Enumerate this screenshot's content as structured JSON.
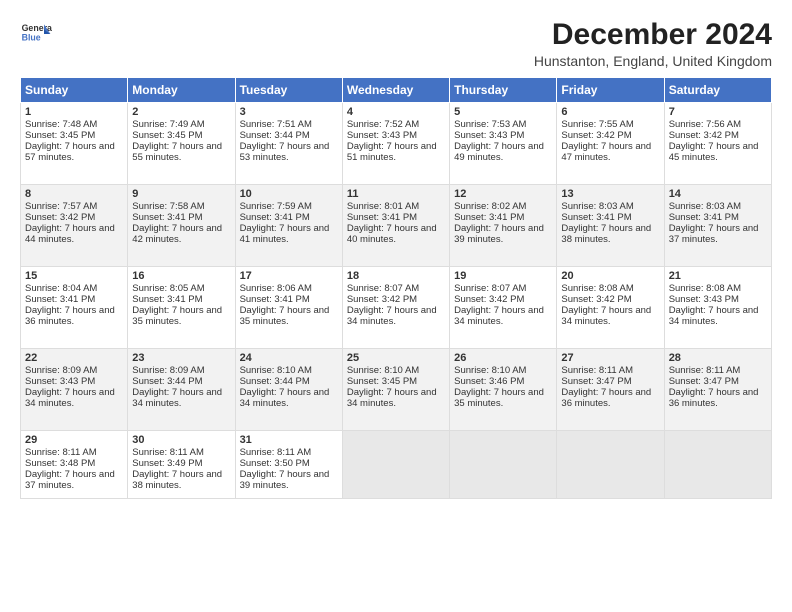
{
  "logo": {
    "line1": "General",
    "line2": "Blue"
  },
  "title": "December 2024",
  "subtitle": "Hunstanton, England, United Kingdom",
  "weekdays": [
    "Sunday",
    "Monday",
    "Tuesday",
    "Wednesday",
    "Thursday",
    "Friday",
    "Saturday"
  ],
  "weeks": [
    [
      {
        "day": "1",
        "sunrise": "Sunrise: 7:48 AM",
        "sunset": "Sunset: 3:45 PM",
        "daylight": "Daylight: 7 hours and 57 minutes."
      },
      {
        "day": "2",
        "sunrise": "Sunrise: 7:49 AM",
        "sunset": "Sunset: 3:45 PM",
        "daylight": "Daylight: 7 hours and 55 minutes."
      },
      {
        "day": "3",
        "sunrise": "Sunrise: 7:51 AM",
        "sunset": "Sunset: 3:44 PM",
        "daylight": "Daylight: 7 hours and 53 minutes."
      },
      {
        "day": "4",
        "sunrise": "Sunrise: 7:52 AM",
        "sunset": "Sunset: 3:43 PM",
        "daylight": "Daylight: 7 hours and 51 minutes."
      },
      {
        "day": "5",
        "sunrise": "Sunrise: 7:53 AM",
        "sunset": "Sunset: 3:43 PM",
        "daylight": "Daylight: 7 hours and 49 minutes."
      },
      {
        "day": "6",
        "sunrise": "Sunrise: 7:55 AM",
        "sunset": "Sunset: 3:42 PM",
        "daylight": "Daylight: 7 hours and 47 minutes."
      },
      {
        "day": "7",
        "sunrise": "Sunrise: 7:56 AM",
        "sunset": "Sunset: 3:42 PM",
        "daylight": "Daylight: 7 hours and 45 minutes."
      }
    ],
    [
      {
        "day": "8",
        "sunrise": "Sunrise: 7:57 AM",
        "sunset": "Sunset: 3:42 PM",
        "daylight": "Daylight: 7 hours and 44 minutes."
      },
      {
        "day": "9",
        "sunrise": "Sunrise: 7:58 AM",
        "sunset": "Sunset: 3:41 PM",
        "daylight": "Daylight: 7 hours and 42 minutes."
      },
      {
        "day": "10",
        "sunrise": "Sunrise: 7:59 AM",
        "sunset": "Sunset: 3:41 PM",
        "daylight": "Daylight: 7 hours and 41 minutes."
      },
      {
        "day": "11",
        "sunrise": "Sunrise: 8:01 AM",
        "sunset": "Sunset: 3:41 PM",
        "daylight": "Daylight: 7 hours and 40 minutes."
      },
      {
        "day": "12",
        "sunrise": "Sunrise: 8:02 AM",
        "sunset": "Sunset: 3:41 PM",
        "daylight": "Daylight: 7 hours and 39 minutes."
      },
      {
        "day": "13",
        "sunrise": "Sunrise: 8:03 AM",
        "sunset": "Sunset: 3:41 PM",
        "daylight": "Daylight: 7 hours and 38 minutes."
      },
      {
        "day": "14",
        "sunrise": "Sunrise: 8:03 AM",
        "sunset": "Sunset: 3:41 PM",
        "daylight": "Daylight: 7 hours and 37 minutes."
      }
    ],
    [
      {
        "day": "15",
        "sunrise": "Sunrise: 8:04 AM",
        "sunset": "Sunset: 3:41 PM",
        "daylight": "Daylight: 7 hours and 36 minutes."
      },
      {
        "day": "16",
        "sunrise": "Sunrise: 8:05 AM",
        "sunset": "Sunset: 3:41 PM",
        "daylight": "Daylight: 7 hours and 35 minutes."
      },
      {
        "day": "17",
        "sunrise": "Sunrise: 8:06 AM",
        "sunset": "Sunset: 3:41 PM",
        "daylight": "Daylight: 7 hours and 35 minutes."
      },
      {
        "day": "18",
        "sunrise": "Sunrise: 8:07 AM",
        "sunset": "Sunset: 3:42 PM",
        "daylight": "Daylight: 7 hours and 34 minutes."
      },
      {
        "day": "19",
        "sunrise": "Sunrise: 8:07 AM",
        "sunset": "Sunset: 3:42 PM",
        "daylight": "Daylight: 7 hours and 34 minutes."
      },
      {
        "day": "20",
        "sunrise": "Sunrise: 8:08 AM",
        "sunset": "Sunset: 3:42 PM",
        "daylight": "Daylight: 7 hours and 34 minutes."
      },
      {
        "day": "21",
        "sunrise": "Sunrise: 8:08 AM",
        "sunset": "Sunset: 3:43 PM",
        "daylight": "Daylight: 7 hours and 34 minutes."
      }
    ],
    [
      {
        "day": "22",
        "sunrise": "Sunrise: 8:09 AM",
        "sunset": "Sunset: 3:43 PM",
        "daylight": "Daylight: 7 hours and 34 minutes."
      },
      {
        "day": "23",
        "sunrise": "Sunrise: 8:09 AM",
        "sunset": "Sunset: 3:44 PM",
        "daylight": "Daylight: 7 hours and 34 minutes."
      },
      {
        "day": "24",
        "sunrise": "Sunrise: 8:10 AM",
        "sunset": "Sunset: 3:44 PM",
        "daylight": "Daylight: 7 hours and 34 minutes."
      },
      {
        "day": "25",
        "sunrise": "Sunrise: 8:10 AM",
        "sunset": "Sunset: 3:45 PM",
        "daylight": "Daylight: 7 hours and 34 minutes."
      },
      {
        "day": "26",
        "sunrise": "Sunrise: 8:10 AM",
        "sunset": "Sunset: 3:46 PM",
        "daylight": "Daylight: 7 hours and 35 minutes."
      },
      {
        "day": "27",
        "sunrise": "Sunrise: 8:11 AM",
        "sunset": "Sunset: 3:47 PM",
        "daylight": "Daylight: 7 hours and 36 minutes."
      },
      {
        "day": "28",
        "sunrise": "Sunrise: 8:11 AM",
        "sunset": "Sunset: 3:47 PM",
        "daylight": "Daylight: 7 hours and 36 minutes."
      }
    ],
    [
      {
        "day": "29",
        "sunrise": "Sunrise: 8:11 AM",
        "sunset": "Sunset: 3:48 PM",
        "daylight": "Daylight: 7 hours and 37 minutes."
      },
      {
        "day": "30",
        "sunrise": "Sunrise: 8:11 AM",
        "sunset": "Sunset: 3:49 PM",
        "daylight": "Daylight: 7 hours and 38 minutes."
      },
      {
        "day": "31",
        "sunrise": "Sunrise: 8:11 AM",
        "sunset": "Sunset: 3:50 PM",
        "daylight": "Daylight: 7 hours and 39 minutes."
      },
      null,
      null,
      null,
      null
    ]
  ]
}
